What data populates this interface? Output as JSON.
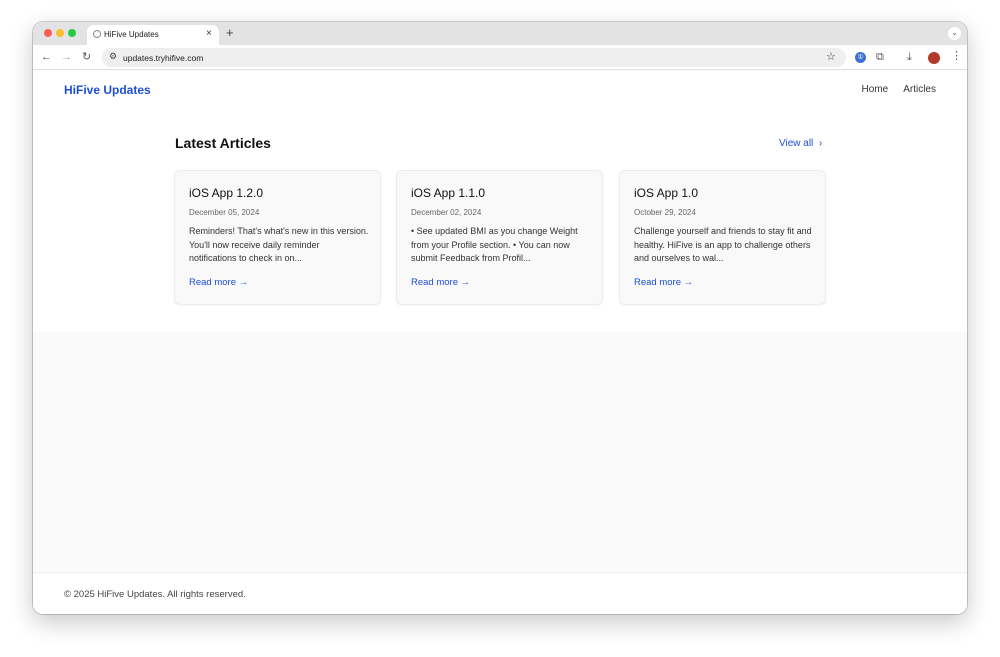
{
  "browser": {
    "tab_title": "HiFive Updates",
    "tab_close": "×",
    "new_tab": "+",
    "tab_menu_icon": "chevron-down-icon",
    "url": "updates.tryhifive.com",
    "traffic_lights": [
      "#ff5f57",
      "#febc2e",
      "#28c840"
    ],
    "toolbar_icons": [
      "back-arrow-icon",
      "forward-arrow-icon",
      "reload-icon",
      "site-settings-icon",
      "bookmark-star-icon",
      "extension-icon",
      "puzzle-icon",
      "download-icon",
      "profile-avatar",
      "more-vertical-icon"
    ]
  },
  "site": {
    "brand": "HiFive Updates",
    "nav": [
      "Home",
      "Articles"
    ],
    "accent_color": "#1d4ed8"
  },
  "latest": {
    "title": "Latest Articles",
    "view_all": "View all",
    "articles": [
      {
        "title": "iOS App 1.2.0",
        "date": "December 05, 2024",
        "excerpt": "Reminders! That's what's new in this version. You'll now receive daily reminder notifications to check in on...",
        "link": "Read more →"
      },
      {
        "title": "iOS App 1.1.0",
        "date": "December 02, 2024",
        "excerpt": "• See updated BMI as you change Weight from your Profile section. • You can now submit Feedback from Profil...",
        "link": "Read more →"
      },
      {
        "title": "iOS App 1.0",
        "date": "October 29, 2024",
        "excerpt": "Challenge yourself and friends to stay fit and healthy. HiFive is an app to challenge others and ourselves to wal...",
        "link": "Read more →"
      }
    ]
  },
  "footer": {
    "copyright": "© 2025 HiFive Updates. All rights reserved."
  }
}
